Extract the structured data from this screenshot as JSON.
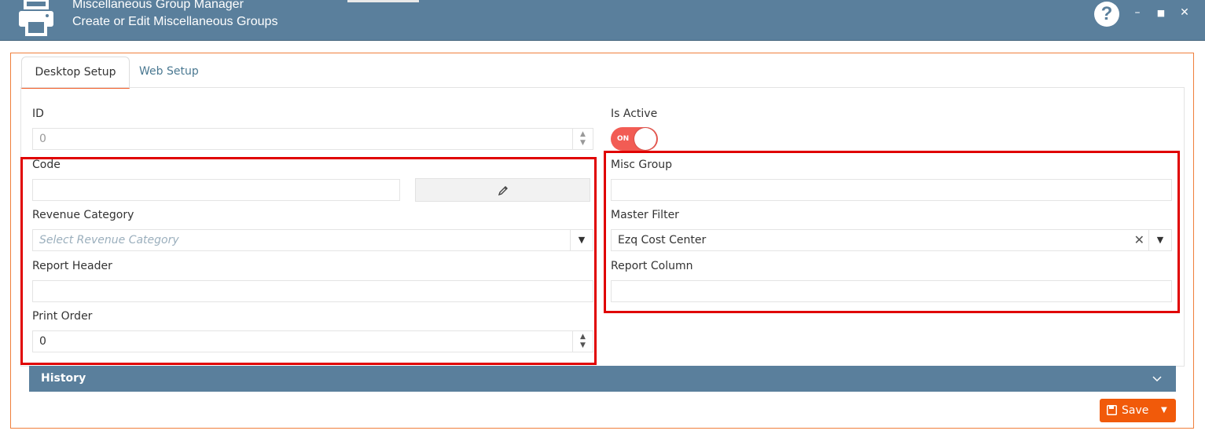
{
  "window": {
    "title": "Miscellaneous Group Manager",
    "subtitle": "Create or Edit Miscellaneous Groups",
    "help_label": "?",
    "minimize": "–",
    "maximize": "■",
    "close": "✕"
  },
  "tabs": [
    {
      "label": "Desktop Setup",
      "active": true
    },
    {
      "label": "Web Setup",
      "active": false
    }
  ],
  "form": {
    "id": {
      "label": "ID",
      "value": "0"
    },
    "is_active": {
      "label": "Is Active",
      "toggle_text": "ON",
      "checked": true
    },
    "code": {
      "label": "Code",
      "value": ""
    },
    "misc_group": {
      "label": "Misc Group",
      "value": ""
    },
    "revenue_category": {
      "label": "Revenue Category",
      "placeholder": "Select Revenue Category"
    },
    "master_filter": {
      "label": "Master Filter",
      "value": "Ezq Cost Center",
      "clear": "✕"
    },
    "report_header": {
      "label": "Report Header",
      "value": ""
    },
    "report_column": {
      "label": "Report Column",
      "value": ""
    },
    "print_order": {
      "label": "Print Order",
      "value": "0"
    }
  },
  "history": {
    "label": "History"
  },
  "footer": {
    "save_label": "Save"
  },
  "colors": {
    "accent": "#f15a0a",
    "header": "#5a7f9c",
    "toggle": "#f25c54",
    "highlight": "#e00000"
  }
}
